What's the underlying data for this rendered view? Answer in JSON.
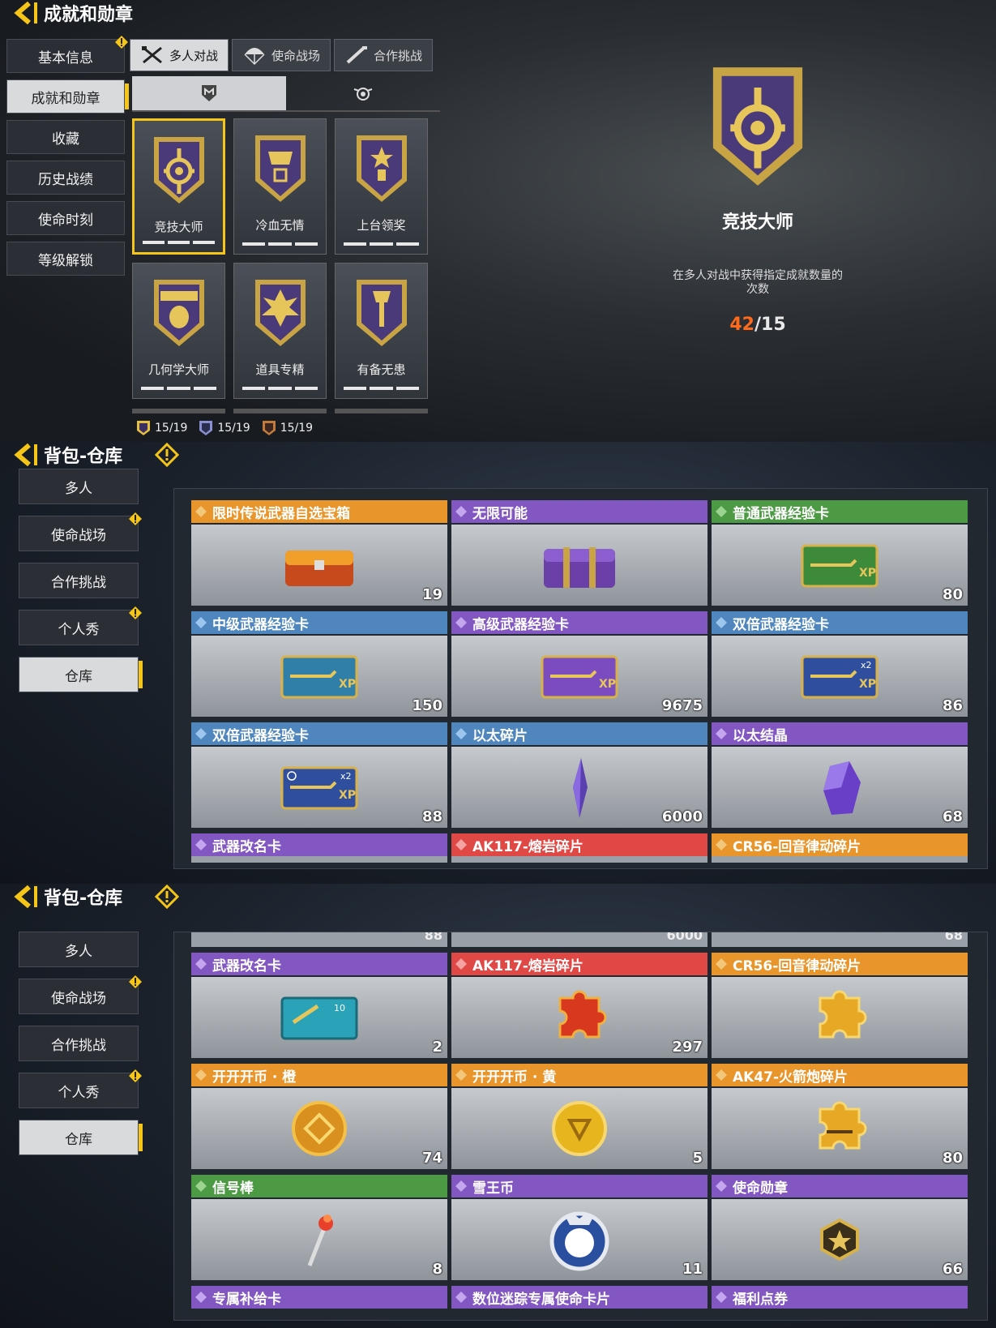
{
  "achievements": {
    "header_title": "成就和勋章",
    "nav": [
      {
        "label": "基本信息",
        "badge": true,
        "selected": false
      },
      {
        "label": "成就和勋章",
        "badge": false,
        "selected": true
      },
      {
        "label": "收藏",
        "badge": false,
        "selected": false
      },
      {
        "label": "历史战绩",
        "badge": false,
        "selected": false
      },
      {
        "label": "使命时刻",
        "badge": false,
        "selected": false
      },
      {
        "label": "等级解锁",
        "badge": false,
        "selected": false
      }
    ],
    "tabs": [
      {
        "label": "多人对战",
        "icon": "crossed-weapons-icon",
        "selected": true
      },
      {
        "label": "使命战场",
        "icon": "parachute-icon",
        "selected": false
      },
      {
        "label": "合作挑战",
        "icon": "rifle-icon",
        "selected": false
      }
    ],
    "subtabs": [
      {
        "icon": "shield-m-icon",
        "selected": true
      },
      {
        "icon": "winged-emblem-icon",
        "selected": false
      }
    ],
    "medals": [
      {
        "name": "竞技大师",
        "icon": "cross-medal-icon",
        "selected": true
      },
      {
        "name": "冷血无情",
        "icon": "dragon-medal-icon",
        "selected": false
      },
      {
        "name": "上台领奖",
        "icon": "trophy-medal-icon",
        "selected": false
      },
      {
        "name": "几何学大师",
        "icon": "grenade-medal-icon",
        "selected": false
      },
      {
        "name": "道具专精",
        "icon": "tnt-medal-icon",
        "selected": false
      },
      {
        "name": "有备无患",
        "icon": "shovel-medal-icon",
        "selected": false
      }
    ],
    "counts": [
      {
        "value": "15/19",
        "color": "#e8c040"
      },
      {
        "value": "15/19",
        "color": "#8a8fd0"
      },
      {
        "value": "15/19",
        "color": "#c07a3a"
      }
    ],
    "detail": {
      "name": "竞技大师",
      "description": "在多人对战中获得指定成就数量的次数",
      "current": "42",
      "target": "/15",
      "accent": "#ff6a1a"
    }
  },
  "inventory1": {
    "header_title": "背包-仓库",
    "nav": [
      {
        "label": "多人",
        "badge": false,
        "selected": false
      },
      {
        "label": "使命战场",
        "badge": true,
        "selected": false
      },
      {
        "label": "合作挑战",
        "badge": false,
        "selected": false
      },
      {
        "label": "个人秀",
        "badge": true,
        "selected": false
      },
      {
        "label": "仓库",
        "badge": false,
        "selected": true
      }
    ],
    "items": [
      {
        "name": "限时传说武器自选宝箱",
        "count": "19",
        "color": "orange",
        "icon": "legendary-chest-icon"
      },
      {
        "name": "无限可能",
        "count": "",
        "color": "purple",
        "icon": "purple-chest-icon"
      },
      {
        "name": "普通武器经验卡",
        "count": "80",
        "color": "green",
        "icon": "green-xp-card-icon"
      },
      {
        "name": "中级武器经验卡",
        "count": "150",
        "color": "blue",
        "icon": "blue-xp-card-icon"
      },
      {
        "name": "高级武器经验卡",
        "count": "9675",
        "color": "purple",
        "icon": "purple-xp-card-icon"
      },
      {
        "name": "双倍武器经验卡",
        "count": "86",
        "color": "blue",
        "icon": "double-xp-card-icon"
      },
      {
        "name": "双倍武器经验卡",
        "count": "88",
        "color": "blue",
        "icon": "double-xp-card-timed-icon"
      },
      {
        "name": "以太碎片",
        "count": "6000",
        "color": "blue",
        "icon": "ether-shard-icon"
      },
      {
        "name": "以太结晶",
        "count": "68",
        "color": "purple",
        "icon": "ether-crystal-icon"
      }
    ],
    "peek_items": [
      {
        "name": "武器改名卡",
        "color": "purple"
      },
      {
        "name": "AK117-熔岩碎片",
        "color": "red"
      },
      {
        "name": "CR56-回音律动碎片",
        "color": "orange"
      }
    ]
  },
  "inventory2": {
    "header_title": "背包-仓库",
    "nav": [
      {
        "label": "多人",
        "badge": false,
        "selected": false
      },
      {
        "label": "使命战场",
        "badge": true,
        "selected": false
      },
      {
        "label": "合作挑战",
        "badge": false,
        "selected": false
      },
      {
        "label": "个人秀",
        "badge": true,
        "selected": false
      },
      {
        "label": "仓库",
        "badge": false,
        "selected": true
      }
    ],
    "top_peek_counts": [
      "88",
      "6000",
      "68"
    ],
    "items": [
      {
        "name": "武器改名卡",
        "count": "2",
        "color": "purple",
        "icon": "rename-card-icon"
      },
      {
        "name": "AK117-熔岩碎片",
        "count": "297",
        "color": "red",
        "icon": "red-puzzle-piece-icon"
      },
      {
        "name": "CR56-回音律动碎片",
        "count": "",
        "color": "orange",
        "icon": "gold-puzzle-piece-icon"
      },
      {
        "name": "开开开币 · 橙",
        "count": "74",
        "color": "orange",
        "icon": "orange-coin-icon"
      },
      {
        "name": "开开开币 · 黄",
        "count": "5",
        "color": "orange",
        "icon": "yellow-coin-icon"
      },
      {
        "name": "AK47-火箭炮碎片",
        "count": "80",
        "color": "orange",
        "icon": "gold-puzzle-piece-icon"
      },
      {
        "name": "信号棒",
        "count": "8",
        "color": "green",
        "icon": "flare-stick-icon"
      },
      {
        "name": "雪王币",
        "count": "11",
        "color": "purple",
        "icon": "snow-king-coin-icon"
      },
      {
        "name": "使命勋章",
        "count": "66",
        "color": "purple",
        "icon": "star-medal-icon"
      }
    ],
    "peek_items": [
      {
        "name": "专属补给卡",
        "color": "purple"
      },
      {
        "name": "数位迷踪专属使命卡片",
        "color": "purple"
      },
      {
        "name": "福利点券",
        "color": "purple"
      }
    ]
  }
}
